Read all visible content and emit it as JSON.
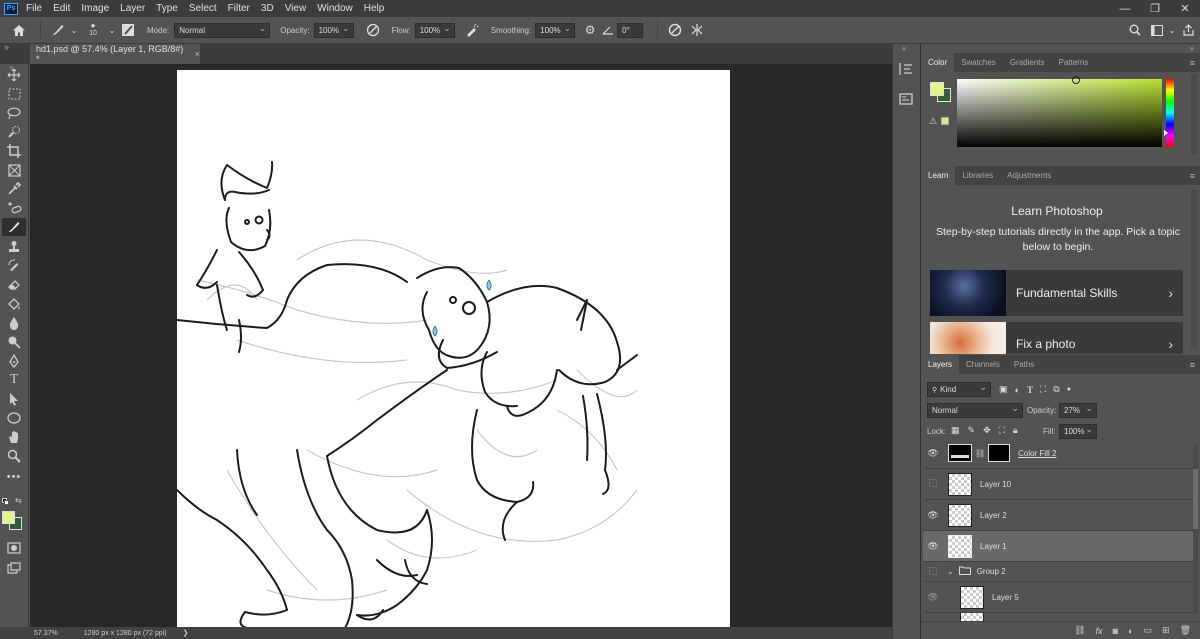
{
  "app": {
    "logo": "Ps"
  },
  "menu": [
    "File",
    "Edit",
    "Image",
    "Layer",
    "Type",
    "Select",
    "Filter",
    "3D",
    "View",
    "Window",
    "Help"
  ],
  "window_controls": [
    "—",
    "❐",
    "✕"
  ],
  "options": {
    "brush_size": "10",
    "mode_label": "Mode:",
    "mode_value": "Normal",
    "opacity_label": "Opacity:",
    "opacity_value": "100%",
    "flow_label": "Flow:",
    "flow_value": "100%",
    "smoothing_label": "Smoothing:",
    "smoothing_value": "100%",
    "angle_value": "0°"
  },
  "doc_tab": {
    "title": "hd1.psd @ 57.4% (Layer 1, RGB/8#) *",
    "close": "×"
  },
  "status": {
    "zoom": "57.37%",
    "info": "1280 px x 1280 px (72 ppi)",
    "arrow": "❯"
  },
  "colors": {
    "foreground": "#e4f58a",
    "background": "#2e5e3a",
    "picker_hue": "#b8e02e"
  },
  "color_panel": {
    "tabs": [
      "Color",
      "Swatches",
      "Gradients",
      "Patterns"
    ]
  },
  "learn_panel": {
    "tabs": [
      "Learn",
      "Libraries",
      "Adjustments"
    ],
    "title": "Learn Photoshop",
    "desc": "Step-by-step tutorials directly in the app. Pick a topic below to begin.",
    "cards": [
      {
        "label": "Fundamental Skills"
      },
      {
        "label": "Fix a photo"
      }
    ]
  },
  "layers_panel": {
    "tabs": [
      "Layers",
      "Channels",
      "Paths"
    ],
    "filter_kind": "Kind",
    "blend_mode": "Normal",
    "opacity_label": "Opacity:",
    "opacity_value": "27%",
    "lock_label": "Lock:",
    "fill_label": "Fill:",
    "fill_value": "100%",
    "layers": [
      {
        "name": "Color Fill 2",
        "visible": true
      },
      {
        "name": "Layer 10",
        "visible": false
      },
      {
        "name": "Layer 2",
        "visible": true
      },
      {
        "name": "Layer 1",
        "visible": true,
        "selected": true
      },
      {
        "name": "Group 2",
        "visible": false
      },
      {
        "name": "Layer 5",
        "visible": true
      }
    ]
  }
}
